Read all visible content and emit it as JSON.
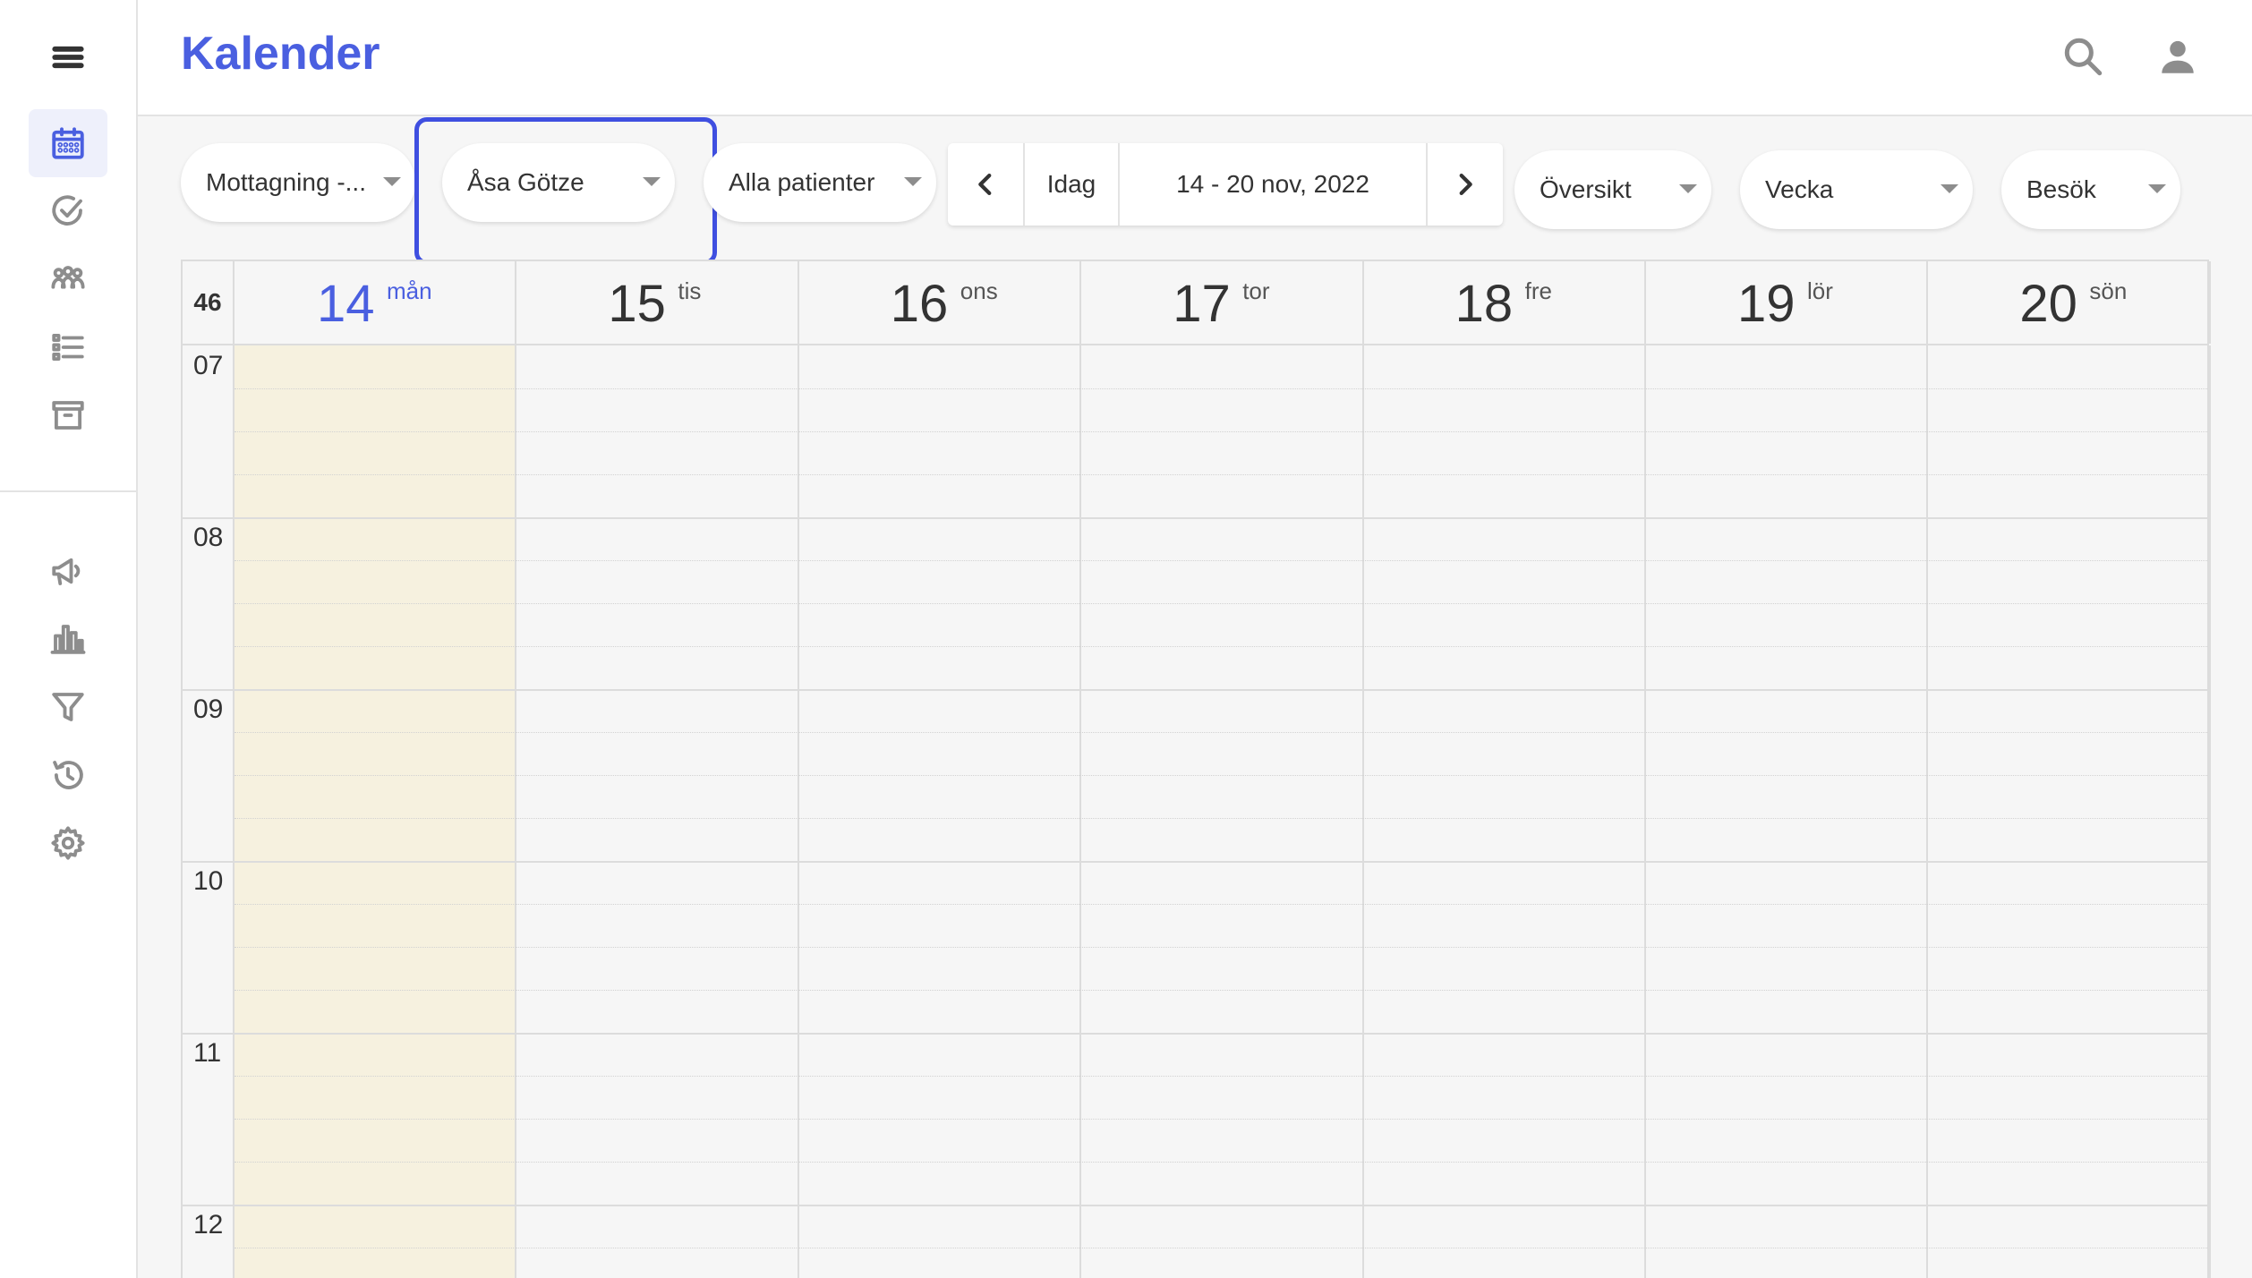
{
  "header": {
    "title": "Kalender",
    "accent_color": "#4a5fe0",
    "icons": [
      "search-icon",
      "account-icon"
    ]
  },
  "sidebar": {
    "menu_icon": "menu-icon",
    "items_top": [
      {
        "icon": "calendar-icon",
        "active": true
      },
      {
        "icon": "check-circle-icon",
        "active": false
      },
      {
        "icon": "group-icon",
        "active": false
      },
      {
        "icon": "list-icon",
        "active": false
      },
      {
        "icon": "archive-icon",
        "active": false
      }
    ],
    "items_bottom": [
      {
        "icon": "megaphone-icon"
      },
      {
        "icon": "bar-chart-icon"
      },
      {
        "icon": "filter-icon"
      },
      {
        "icon": "history-icon"
      },
      {
        "icon": "settings-icon"
      }
    ]
  },
  "toolbar": {
    "clinic_select": "Mottagning -...",
    "staff_select": "Åsa Götze",
    "patients_select": "Alla patienter",
    "today_label": "Idag",
    "date_range": "14 - 20 nov, 2022",
    "overview_select": "Översikt",
    "period_select": "Vecka",
    "type_select": "Besök"
  },
  "calendar": {
    "week_number": "46",
    "days": [
      {
        "num": "14",
        "name": "mån",
        "today": true
      },
      {
        "num": "15",
        "name": "tis",
        "today": false
      },
      {
        "num": "16",
        "name": "ons",
        "today": false
      },
      {
        "num": "17",
        "name": "tor",
        "today": false
      },
      {
        "num": "18",
        "name": "fre",
        "today": false
      },
      {
        "num": "19",
        "name": "lör",
        "today": false
      },
      {
        "num": "20",
        "name": "sön",
        "today": false
      }
    ],
    "hours": [
      "07",
      "08",
      "09",
      "10",
      "11",
      "12"
    ],
    "today_column_color": "#f6f1df"
  }
}
